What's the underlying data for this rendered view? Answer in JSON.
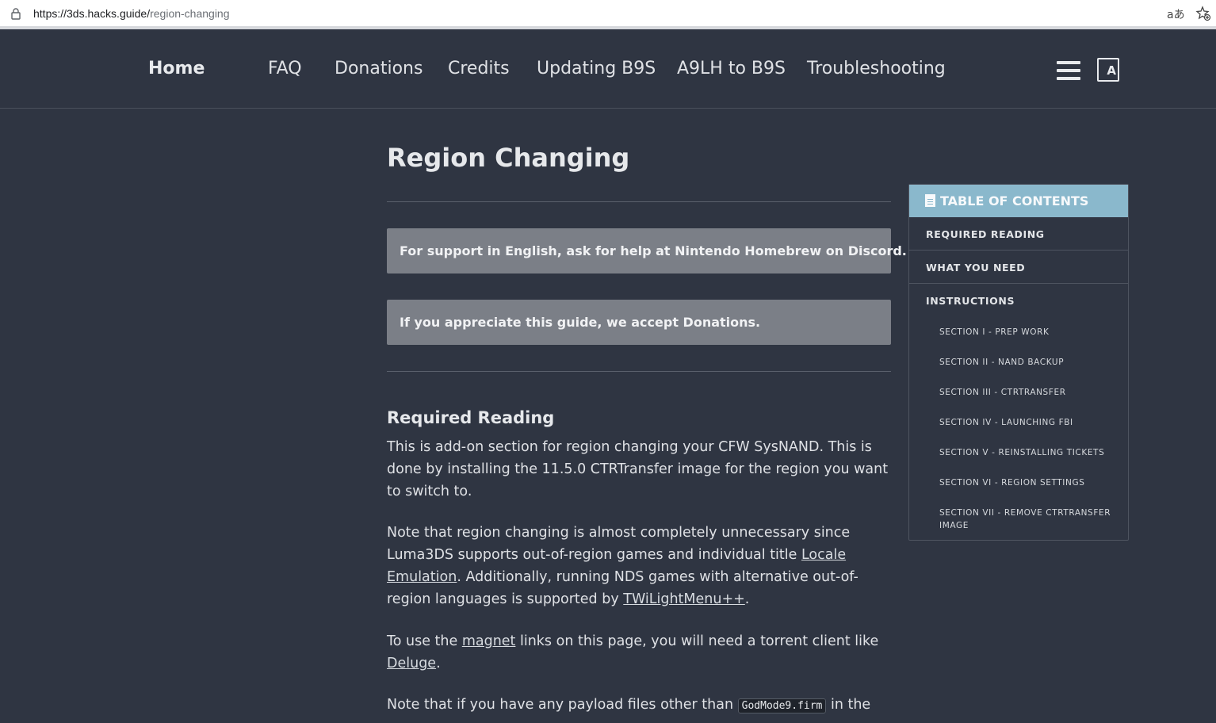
{
  "browser": {
    "url_host": "https://3ds.hacks.guide/",
    "url_path": "region-changing",
    "translate_glyph": "aあ"
  },
  "nav": {
    "home": "Home",
    "links": [
      "FAQ",
      "Donations",
      "Credits",
      "Updating B9S",
      "A9LH to B9S",
      "Troubleshooting"
    ],
    "lang_glyph": "A"
  },
  "page": {
    "title": "Region Changing",
    "notice_support": "For support in English, ask for help at Nintendo Homebrew on Discord.",
    "notice_donate": "If you appreciate this guide, we accept Donations.",
    "required_heading": "Required Reading",
    "p1": "This is add-on section for region changing your CFW SysNAND. This is done by installing the 11.5.0 CTRTransfer image for the region you want to switch to.",
    "p2_a": "Note that region changing is almost completely unnecessary since Luma3DS supports out-of-region games and individual title ",
    "p2_link1": "Locale Emulation",
    "p2_b": ". Additionally, running NDS games with alternative out-of-region languages is supported by ",
    "p2_link2": "TWiLightMenu++",
    "p2_c": ".",
    "p3_a": "To use the ",
    "p3_link1": "magnet",
    "p3_b": " links on this page, you will need a torrent client like ",
    "p3_link2": "Deluge",
    "p3_c": ".",
    "p4_a": "Note that if you have any payload files other than ",
    "p4_code": "GodMode9.firm",
    "p4_b": " in the"
  },
  "toc": {
    "header": "TABLE OF CONTENTS",
    "items": [
      "REQUIRED READING",
      "WHAT YOU NEED",
      "INSTRUCTIONS"
    ],
    "subitems": [
      "SECTION I - PREP WORK",
      "SECTION II - NAND BACKUP",
      "SECTION III - CTRTRANSFER",
      "SECTION IV - LAUNCHING FBI",
      "SECTION V - REINSTALLING TICKETS",
      "SECTION VI - REGION SETTINGS",
      "SECTION VII - REMOVE CTRTRANSFER IMAGE"
    ]
  },
  "colors": {
    "background": "#2f3542",
    "notice": "#7b7f87",
    "toc_header": "#8ab8cc"
  }
}
